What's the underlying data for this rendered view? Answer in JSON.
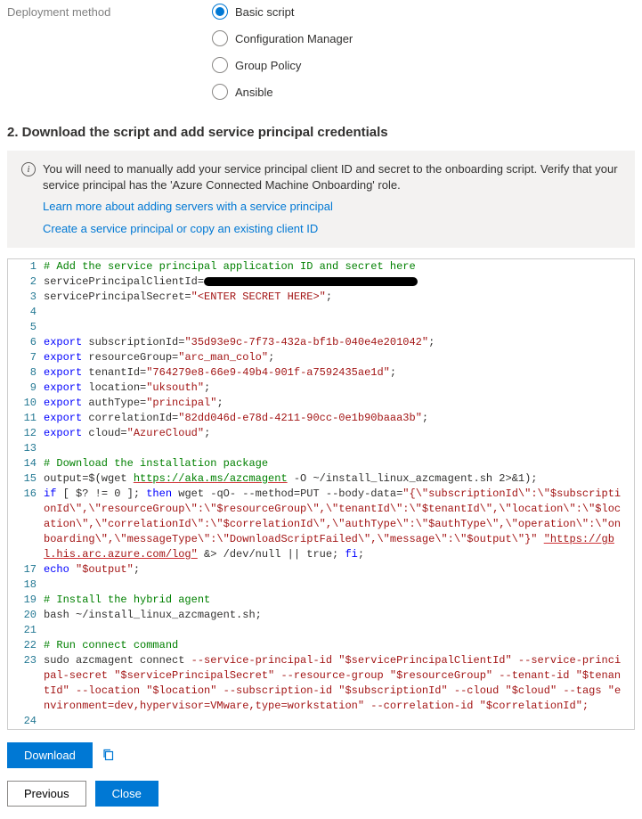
{
  "form": {
    "deploy_label": "Deployment method",
    "options": {
      "basic": "Basic script",
      "config": "Configuration Manager",
      "gp": "Group Policy",
      "ansible": "Ansible"
    }
  },
  "section2": {
    "title": "2. Download the script and add service principal credentials",
    "info_text": "You will need to manually add your service principal client ID and secret to the onboarding script. Verify that your service principal has the 'Azure Connected Machine Onboarding' role.",
    "link1": "Learn more about adding servers with a service principal",
    "link2": "Create a service principal or copy an existing client ID"
  },
  "script": {
    "l1": "# Add the service principal application ID and secret here",
    "l2a": "servicePrincipalClientId=",
    "l3a": "servicePrincipalSecret=",
    "l3b": "\"<ENTER SECRET HERE>\"",
    "l3c": ";",
    "l6_kw": "export",
    "l6_var": " subscriptionId=",
    "l6_str": "\"35d93e9c-7f73-432a-bf1b-040e4e201042\"",
    "l6_end": ";",
    "l7_var": " resourceGroup=",
    "l7_str": "\"arc_man_colo\"",
    "l8_var": " tenantId=",
    "l8_str": "\"764279e8-66e9-49b4-901f-a7592435ae1d\"",
    "l9_var": " location=",
    "l9_str": "\"uksouth\"",
    "l10_var": " authType=",
    "l10_str": "\"principal\"",
    "l11_var": " correlationId=",
    "l11_str": "\"82dd046d-e78d-4211-90cc-0e1b90baaa3b\"",
    "l12_var": " cloud=",
    "l12_str": "\"AzureCloud\"",
    "l14": "# Download the installation package",
    "l15a": "output=$(wget ",
    "l15url": "https://aka.ms/azcmagent",
    "l15b": " -O ~/install_linux_azcmagent.sh 2>&1);",
    "l16a": "if",
    "l16b": " [ $? != 0 ]; ",
    "l16c": "then",
    "l16d": " wget -qO- --method=PUT --body-data=",
    "l16e": "\"{\\\"subscriptionId\\\":\\\"$subscriptionId\\\",\\\"resourceGroup\\\":\\\"$resourceGroup\\\",\\\"tenantId\\\":\\\"$tenantId\\\",\\\"location\\\":\\\"$location\\\",\\\"correlationId\\\":\\\"$correlationId\\\",\\\"authType\\\":\\\"$authType\\\",\\\"operation\\\":\\\"onboarding\\\",\\\"messageType\\\":\\\"DownloadScriptFailed\\\",\\\"message\\\":\\\"$output\\\"}\"",
    "l16f": " ",
    "l16url": "\"https://gbl.his.arc.azure.com/log\"",
    "l16g": " &> /dev/null || true; ",
    "l16h": "fi",
    "l16i": ";",
    "l17a": "echo",
    "l17b": " ",
    "l17c": "\"$output\"",
    "l17d": ";",
    "l19": "# Install the hybrid agent",
    "l20": "bash ~/install_linux_azcmagent.sh;",
    "l22": "# Run connect command",
    "l23a": "sudo azcmagent connect ",
    "l23_f1": "--service-principal-id",
    "l23_v1": " \"$servicePrincipalClientId\" ",
    "l23_f2": "--service-principal-secret",
    "l23_v2": " \"$servicePrincipalSecret\" ",
    "l23_f3": "--resource-group",
    "l23_v3": " \"$resourceGroup\" ",
    "l23_f4": "--tenant-id",
    "l23_v4": " \"$tenantId\" ",
    "l23_f5": "--location",
    "l23_v5": " \"$location\" ",
    "l23_f6": "--subscription-id",
    "l23_v6": " \"$subscriptionId\" ",
    "l23_f7": "--cloud",
    "l23_v7": " \"$cloud\" ",
    "l23_f8": "--tags",
    "l23_v8": " \"environment=dev,hypervisor=VMware,type=workstation\" ",
    "l23_f9": "--correlation-id",
    "l23_v9": " \"$correlationId\";"
  },
  "buttons": {
    "download": "Download",
    "previous": "Previous",
    "close": "Close"
  }
}
